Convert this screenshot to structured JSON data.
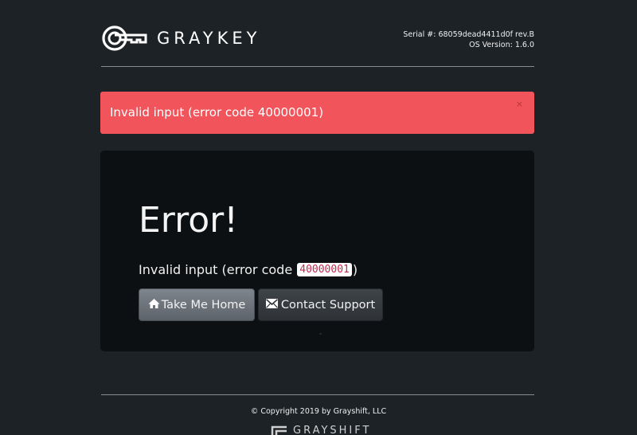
{
  "header": {
    "logo_text": "GRAYKEY",
    "serial": "Serial #: 68059dead4411d0f rev.B",
    "os_version": "OS Version: 1.6.0"
  },
  "alert": {
    "message": "Invalid input (error code 40000001)",
    "close_label": "×",
    "color": "#f2545b"
  },
  "panel": {
    "title": "Error!",
    "message_prefix": "Invalid input (error code ",
    "error_code": "40000001",
    "message_suffix": ")",
    "buttons": {
      "home_label": "Take Me Home",
      "home_icon": "home-icon",
      "support_label": "Contact Support",
      "support_icon": "envelope-icon"
    }
  },
  "footer": {
    "copyright": "© Copyright 2019 by Grayshift, LLC",
    "logo_text": "GRAYSHIFT"
  },
  "colors": {
    "background": "#1d2226",
    "panel": "#0d1012",
    "alert": "#f2545b",
    "code_text": "#c7254e"
  }
}
